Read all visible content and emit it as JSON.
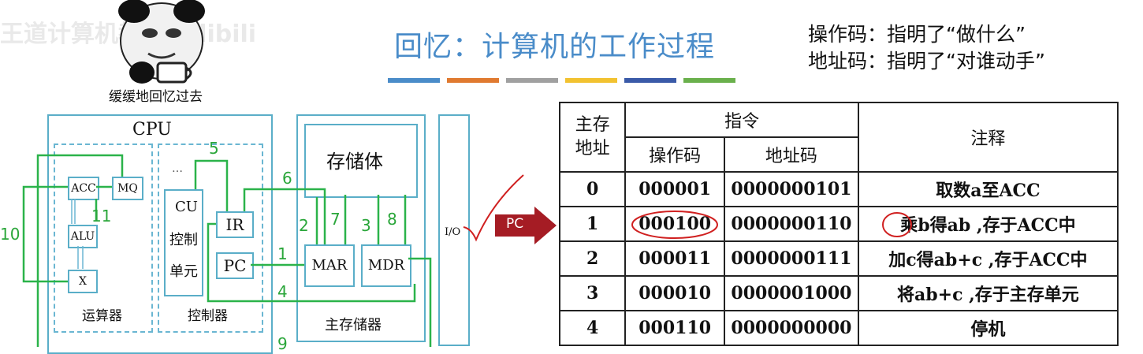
{
  "watermark": "王道计算机教育 bilibili",
  "meme": {
    "caption": "缓缓地回忆过去"
  },
  "title": "回忆：计算机的工作过程",
  "notes": [
    "操作码：指明了“做什么”",
    "地址码：指明了“对谁动手”"
  ],
  "title_bar_colors": [
    "#4a8cc9",
    "#e07a30",
    "#a0a0a0",
    "#f2c230",
    "#3a5aa8",
    "#6ab04c"
  ],
  "diagram": {
    "cpu_label": "CPU",
    "alu_unit": "运算器",
    "control_unit": "控制器",
    "acc": "ACC",
    "mq": "MQ",
    "alu": "ALU",
    "x": "X",
    "cu": [
      "CU",
      "控制",
      "单元"
    ],
    "ir": "IR",
    "pc": "PC",
    "mar": "MAR",
    "mdr": "MDR",
    "storage": "存储体",
    "main_memory": "主存储器",
    "io": "I/O",
    "dots": "…",
    "step_numbers": [
      "1",
      "2",
      "3",
      "4",
      "5",
      "6",
      "7",
      "8",
      "9",
      "10",
      "11"
    ]
  },
  "pc_pointer": "PC",
  "table": {
    "headers": {
      "address": [
        "主存",
        "地址"
      ],
      "instruction": "指令",
      "opcode": "操作码",
      "addrcode": "地址码",
      "comment": "注释"
    },
    "rows": [
      {
        "addr": "0",
        "op": "000001",
        "ad": "0000000101",
        "comment": "取数a至ACC"
      },
      {
        "addr": "1",
        "op": "000100",
        "ad": "0000000110",
        "comment": "乘b得ab ,存于ACC中"
      },
      {
        "addr": "2",
        "op": "000011",
        "ad": "0000000111",
        "comment": "加c得ab+c  ,存于ACC中"
      },
      {
        "addr": "3",
        "op": "000010",
        "ad": "0000001000",
        "comment": "将ab+c ,存于主存单元"
      },
      {
        "addr": "4",
        "op": "000110",
        "ad": "0000000000",
        "comment": "停机"
      }
    ]
  }
}
